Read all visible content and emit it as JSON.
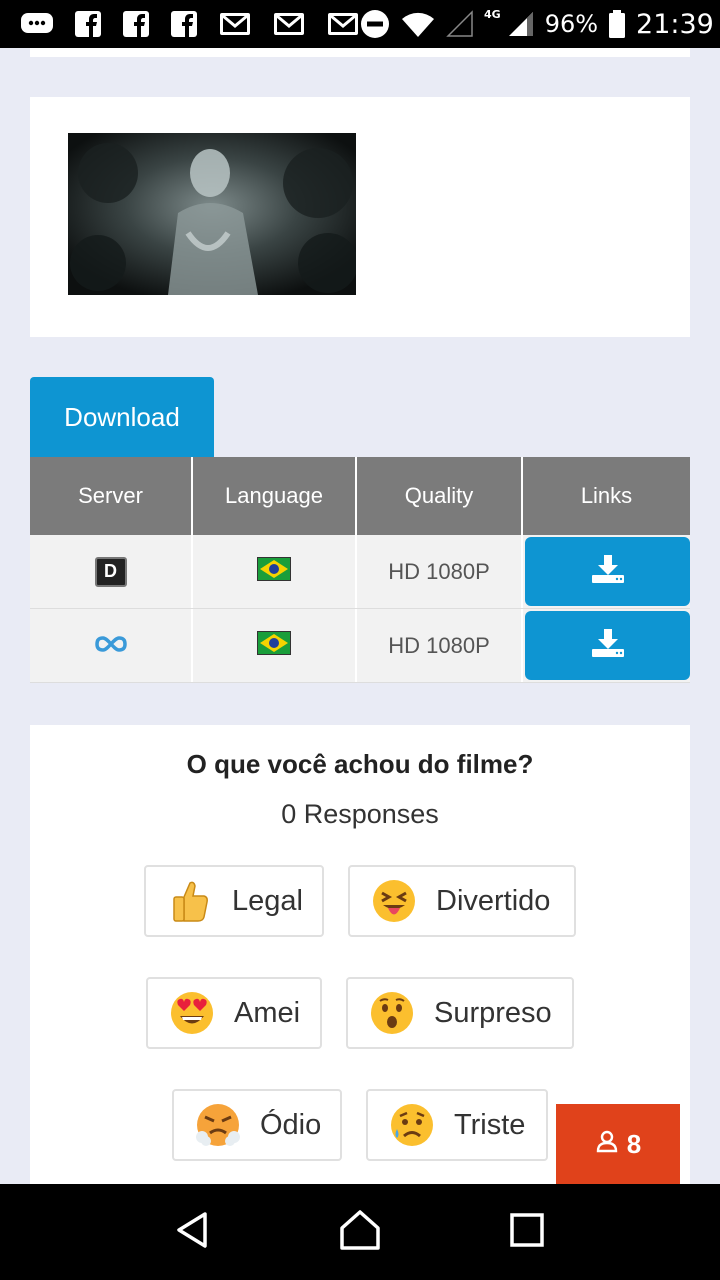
{
  "status_bar": {
    "network": "4G",
    "battery": "96%",
    "time": "21:39"
  },
  "download_tab": {
    "label": "Download"
  },
  "table": {
    "headers": [
      "Server",
      "Language",
      "Quality",
      "Links"
    ],
    "rows": [
      {
        "server_icon": "server-d-icon",
        "language_icon": "brazil-flag-icon",
        "quality": "HD 1080P",
        "link_icon": "download-icon"
      },
      {
        "server_icon": "infinity-icon",
        "language_icon": "brazil-flag-icon",
        "quality": "HD 1080P",
        "link_icon": "download-icon"
      }
    ],
    "server_letter": "D"
  },
  "reactions": {
    "title": "O que você achou do filme?",
    "responses": "0 Responses",
    "buttons": [
      {
        "label": "Legal",
        "icon": "thumbs-up-icon"
      },
      {
        "label": "Divertido",
        "icon": "tongue-emoji-icon"
      },
      {
        "label": "Amei",
        "icon": "heart-eyes-emoji-icon"
      },
      {
        "label": "Surpreso",
        "icon": "surprised-emoji-icon"
      },
      {
        "label": "Ódio",
        "icon": "angry-emoji-icon"
      },
      {
        "label": "Triste",
        "icon": "sad-emoji-icon"
      }
    ]
  },
  "users_badge": {
    "count": "8"
  },
  "colors": {
    "accent": "#0e95d2",
    "header_gray": "#7b7b7b",
    "badge": "#e0421b",
    "page_bg": "#e9ebf5"
  }
}
